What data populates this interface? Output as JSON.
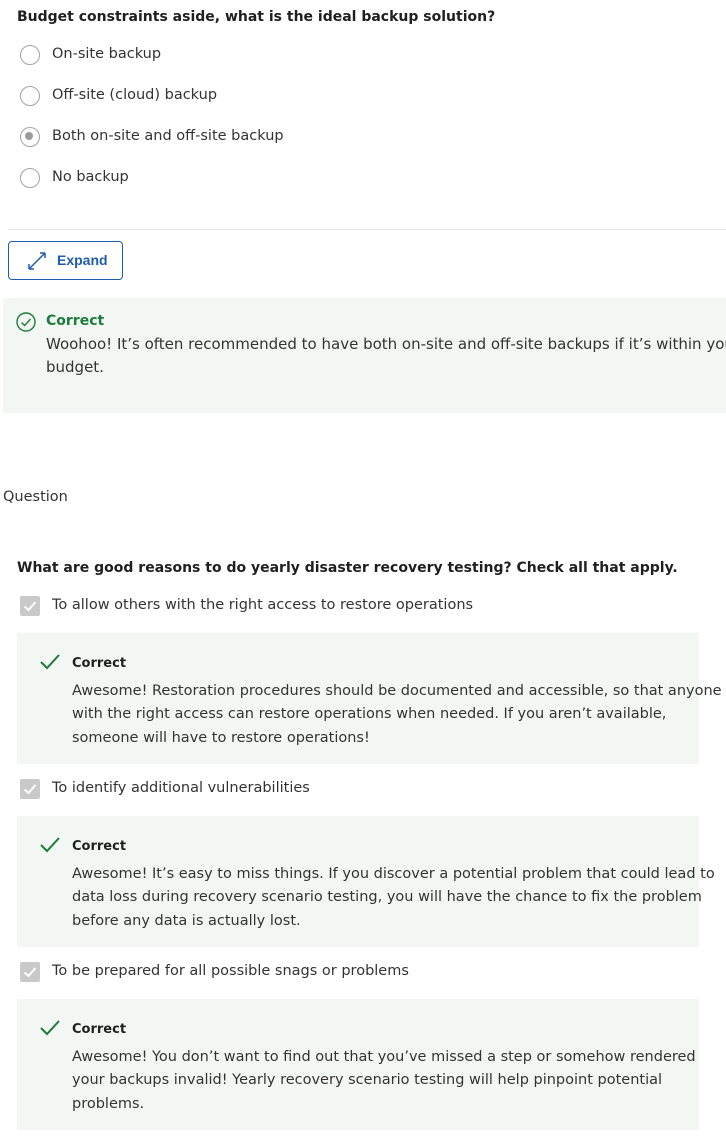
{
  "q1": {
    "title": "Budget constraints aside, what is the ideal backup solution?",
    "options": [
      "On-site backup",
      "Off-site (cloud) backup",
      "Both on-site and off-site backup",
      "No backup"
    ],
    "selected_index": 2
  },
  "expand": {
    "label": "Expand"
  },
  "q1_feedback": {
    "title": "Correct",
    "line1": "Woohoo! It’s often recommended to have both on-site and off-site backups if it’s within your org",
    "line2": "budget."
  },
  "section": {
    "label": "Question"
  },
  "q2": {
    "title": "What are good reasons to do yearly disaster recovery testing? Check all that apply.",
    "items": [
      {
        "label": "To allow others with the right access to restore operations",
        "checked": true,
        "feedback_title": "Correct",
        "feedback_lines": [
          "Awesome! Restoration procedures should be documented and accessible, so that anyone",
          "with the right access can restore operations when needed. If you aren’t available,",
          "someone will have to restore operations!"
        ]
      },
      {
        "label": "To identify additional vulnerabilities",
        "checked": true,
        "feedback_title": "Correct",
        "feedback_lines": [
          "Awesome! It’s easy to miss things. If you discover a potential problem that could lead to",
          "data loss during recovery scenario testing, you will have the chance to fix the problem",
          "before any data is actually lost."
        ]
      },
      {
        "label": "To be prepared for all possible snags or problems",
        "checked": true,
        "feedback_title": "Correct",
        "feedback_lines": [
          "Awesome! You don’t want to find out that you’ve missed a step or somehow rendered",
          "your backups invalid! Yearly recovery scenario testing will help pinpoint potential",
          "problems."
        ]
      }
    ]
  },
  "colors": {
    "accent": "#1f5ca9",
    "correct_green": "#1e7a3c",
    "feedback_bg": "#f2f7f4"
  },
  "icons": {
    "expand": "expand-arrows-icon",
    "correct_circle": "check-circle-icon",
    "check": "check-icon"
  }
}
